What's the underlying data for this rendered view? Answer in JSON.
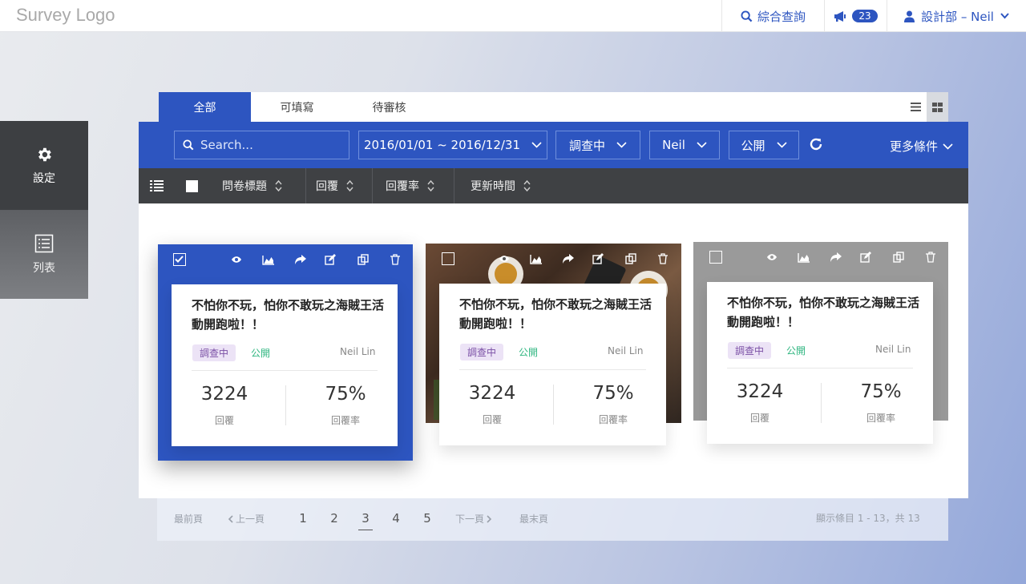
{
  "header": {
    "logo": "Survey Logo",
    "search_label": "綜合查詢",
    "notification_count": "23",
    "user_label": "設計部 – Neil"
  },
  "sidebar": {
    "items": [
      {
        "label": "設定",
        "icon": "gear-icon"
      },
      {
        "label": "列表",
        "icon": "list-icon"
      }
    ]
  },
  "tabs": [
    {
      "label": "全部",
      "active": true
    },
    {
      "label": "可填寫"
    },
    {
      "label": "待審核"
    }
  ],
  "filters": {
    "search_placeholder": "Search...",
    "date_range": "2016/01/01 ~ 2016/12/31",
    "status": "調查中",
    "user": "Neil",
    "visibility": "公開",
    "more": "更多條件"
  },
  "columns": [
    "問卷標題",
    "回覆",
    "回覆率",
    "更新時間"
  ],
  "cards": [
    {
      "title": "不怕你不玩，怕你不敢玩之海賊王活動開跑啦！！",
      "status": "調查中",
      "visibility": "公開",
      "author": "Neil Lin",
      "responses": "3224",
      "responses_label": "回覆",
      "rate": "75%",
      "rate_label": "回覆率",
      "selected": true
    },
    {
      "title": "不怕你不玩，怕你不敢玩之海賊王活動開跑啦！！",
      "status": "調查中",
      "visibility": "公開",
      "author": "Neil Lin",
      "responses": "3224",
      "responses_label": "回覆",
      "rate": "75%",
      "rate_label": "回覆率",
      "selected": false
    },
    {
      "title": "不怕你不玩，怕你不敢玩之海賊王活動開跑啦！！",
      "status": "調查中",
      "visibility": "公開",
      "author": "Neil Lin",
      "responses": "3224",
      "responses_label": "回覆",
      "rate": "75%",
      "rate_label": "回覆率",
      "selected": false
    }
  ],
  "pagination": {
    "first": "最前頁",
    "prev": "上一頁",
    "pages": [
      "1",
      "2",
      "3",
      "4",
      "5"
    ],
    "current": "3",
    "next": "下一頁",
    "last": "最末頁",
    "summary": "顯示條目 1 - 13，共 13"
  },
  "colors": {
    "primary": "#2d55c0",
    "dark": "#3f4144",
    "tag_bg": "#ece3f6",
    "public_green": "#2fb680"
  }
}
